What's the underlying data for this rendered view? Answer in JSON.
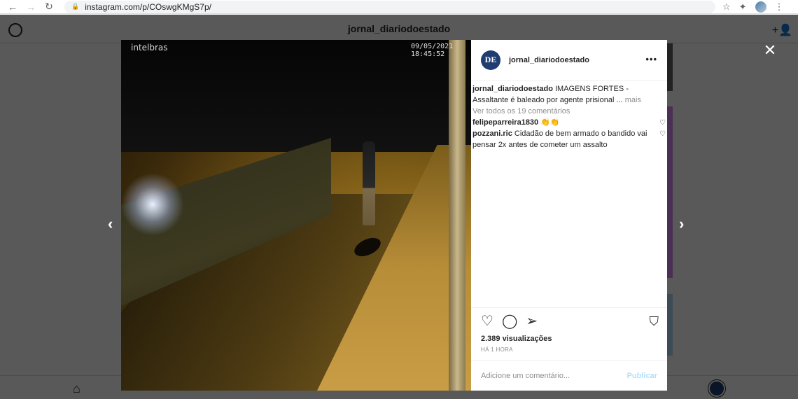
{
  "browser": {
    "back_icon": "←",
    "forward_icon": "→",
    "reload_icon": "↻",
    "url": "instagram.com/p/COswgKMgS7p/",
    "star_icon": "☆",
    "extensions_icon": "✦",
    "menu_icon": "⋮"
  },
  "ig": {
    "header_title": "jornal_diariodoestado",
    "add_user_icon": "+👤",
    "home_icon": "⌂"
  },
  "overlay": {
    "close_icon": "✕",
    "prev_icon": "‹",
    "next_icon": "›"
  },
  "video": {
    "brand": "intelbras",
    "timestamp": "09/05/2021 18:45:52"
  },
  "post": {
    "logo_text": "DE",
    "username": "jornal_diariodoestado",
    "more_icon": "•••",
    "caption_user": "jornal_diariodoestado",
    "caption_text": " IMAGENS FORTES - Assaltante é baleado por agente prisional ...",
    "caption_more": " mais",
    "view_all": "Ver todos os 19 comentários",
    "comments": [
      {
        "user": "felipeparreira1830",
        "text": " 👏👏"
      },
      {
        "user": "pozzani.ric",
        "text": " Cidadão de bem armado o bandido vai pensar 2x antes de cometer um assalto"
      }
    ],
    "heart_icon": "♡",
    "comment_icon": "◯",
    "share_icon": "➢",
    "bookmark_icon": "⛉",
    "views": "2.389 visualizações",
    "time": "HÁ 1 HORA",
    "comment_placeholder": "Adicione um comentário...",
    "publish_label": "Publicar"
  }
}
